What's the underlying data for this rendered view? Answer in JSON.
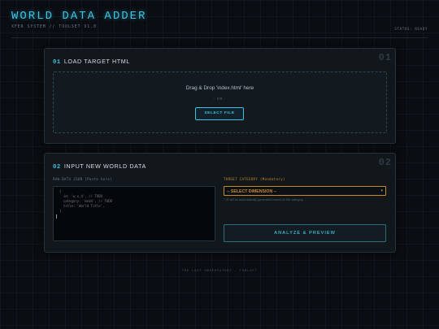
{
  "header": {
    "title": "WORLD DATA ADDER",
    "subtitle": "XFER SYSTEM // TOOLSET V1.0",
    "status": "STATUS: READY"
  },
  "section1": {
    "number": "01",
    "title": "LOAD TARGET HTML",
    "ghost_number": "01",
    "dropzone_text": "Drag & Drop 'index.html' here",
    "dropzone_or": "- OR -",
    "select_button": "SELECT FILE"
  },
  "section2": {
    "number": "02",
    "title": "INPUT NEW WORLD DATA",
    "ghost_number": "02",
    "json_label": "RAW DATA JSON [Paste here]",
    "json_lines": [
      "{",
      "  id: 'w_x_d', // TODO",
      "  category: 'mnd4', // TODO",
      "  title: 'World Title',",
      "}"
    ],
    "category_label": "TARGET CATEGORY (Mandatory)",
    "category_value": "-- SELECT DIMENSION --",
    "category_hint": "* ID will be automatically generated based on the category.",
    "analyze_button": "ANALYZE & PREVIEW"
  },
  "footer": {
    "text": "THE LAST OBSERVATORY - TOOLSET"
  },
  "colors": {
    "accent": "#39c3e4",
    "warning": "#c98a2d",
    "background": "#0a0d11",
    "panel": "#12171c"
  },
  "icons": {
    "select_chevron": "chevron-down-icon"
  }
}
